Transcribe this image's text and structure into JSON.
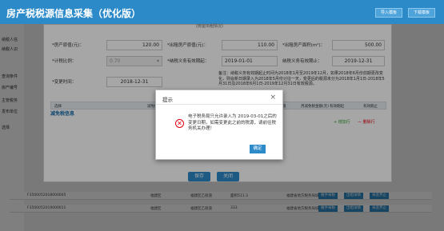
{
  "header": {
    "title": "房产税税源信息采集（优化版）",
    "import_label": "导入模板",
    "download_label": "下载模板"
  },
  "sidebar": {
    "items": [
      "纳税人信",
      "纳税人识",
      "查询条件",
      "房产编号",
      "主管税务",
      "发布单位",
      "选择"
    ]
  },
  "panel": {
    "top_title": "(房屋出租情况)",
    "rows": {
      "r1": {
        "label1": "*房产原值(元)：",
        "value1": "120.00",
        "label2": "*出租房产原值(元)：",
        "value2": "110.00",
        "label3": "*出租房产面积(m²)：",
        "value3": "500.00"
      },
      "r2": {
        "label1": "*计税比例：",
        "value1": "0.70",
        "label2": "*纳税义务有效期起：",
        "value2": "2019-01-01",
        "label3": "纳税义务有效期止：",
        "value3": "2019-12-31"
      },
      "r3": {
        "label1": "*变更时间：",
        "value1": "2018-12-31",
        "remark": "备注：纳税义务有效期起止时间为2018年1月至2019年12月，如果2018年6月份前期更改变化，则会新日期录入为2018年5月份计征一天，变更后的税源未分为2018年1月1日-2018年5月31日及2018年6月1日-2019年12月31日有效税源。"
      }
    },
    "section_title": "减免税信息",
    "table_headers": [
      "选择",
      "减免性质代码",
      "减免起止时间",
      "减免税房产原值",
      "月减免税金额(元)",
      "有效期起",
      "有效期止"
    ],
    "add_row": "增加行",
    "del_row": "删除行",
    "save_label": "保存",
    "close_label": "关闭"
  },
  "bg_rows": [
    {
      "id": "F3500052018000005",
      "loc": "福建区",
      "name": "福建区乙街道",
      "area": "面积511.3",
      "type": "福建省地方税务局城内分局",
      "b1": "撤手采税",
      "b2": "出租详情",
      "b3": "采变弃止"
    },
    {
      "id": "F3500052019000011",
      "loc": "福建区",
      "name": "福建区乙街道",
      "area": "333",
      "type": "福建省地方税务局城内分局",
      "b1": "撤手采税",
      "b2": "出租详情",
      "b3": "采变弃止"
    }
  ],
  "dialog": {
    "title": "提示",
    "message": "电子税务局只允许录入为 2019-03-01之后的变更日期，如需变更此之前的税源，请前往税务机关办理！",
    "ok_label": "确定",
    "close_glyph": "×",
    "icon_glyph": "✕"
  },
  "colors": {
    "header": "#2c8ac9",
    "required": "#e60012",
    "add": "#2a9d2a",
    "del": "#e60012"
  }
}
